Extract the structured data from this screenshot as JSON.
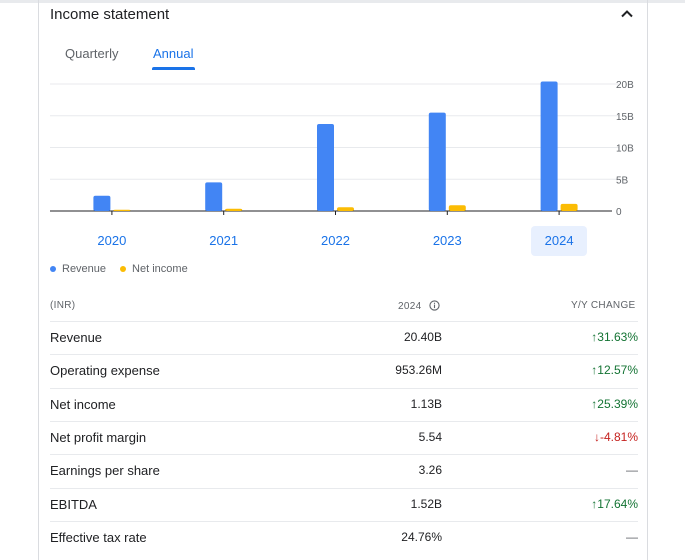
{
  "header": {
    "title": "Income statement"
  },
  "tabs": [
    {
      "label": "Quarterly"
    },
    {
      "label": "Annual"
    }
  ],
  "chart_data": {
    "type": "bar",
    "categories": [
      "2020",
      "2021",
      "2022",
      "2023",
      "2024"
    ],
    "series": [
      {
        "name": "Revenue",
        "color": "#4285f4",
        "values": [
          2.4,
          4.5,
          13.7,
          15.5,
          20.4
        ]
      },
      {
        "name": "Net income",
        "color": "#fbbc04",
        "values": [
          0.2,
          0.35,
          0.6,
          0.9,
          1.13
        ]
      }
    ],
    "yticks": [
      "0",
      "5B",
      "10B",
      "15B",
      "20B"
    ],
    "ylim": [
      0,
      20
    ],
    "selected_category": "2024",
    "grid": true,
    "legend_placement": "bottom-left"
  },
  "legend": [
    {
      "label": "Revenue",
      "color": "#4285f4"
    },
    {
      "label": "Net income",
      "color": "#fbbc04"
    }
  ],
  "table": {
    "col_currency": "(INR)",
    "col_year": "2024",
    "col_change": "Y/Y CHANGE",
    "rows": [
      {
        "label": "Revenue",
        "value": "20.40B",
        "change": "31.63%",
        "dir": "up"
      },
      {
        "label": "Operating expense",
        "value": "953.26M",
        "change": "12.57%",
        "dir": "up"
      },
      {
        "label": "Net income",
        "value": "1.13B",
        "change": "25.39%",
        "dir": "up"
      },
      {
        "label": "Net profit margin",
        "value": "5.54",
        "change": "-4.81%",
        "dir": "down"
      },
      {
        "label": "Earnings per share",
        "value": "3.26",
        "change": "—",
        "dir": "flat"
      },
      {
        "label": "EBITDA",
        "value": "1.52B",
        "change": "17.64%",
        "dir": "up"
      },
      {
        "label": "Effective tax rate",
        "value": "24.76%",
        "change": "—",
        "dir": "flat"
      }
    ]
  }
}
